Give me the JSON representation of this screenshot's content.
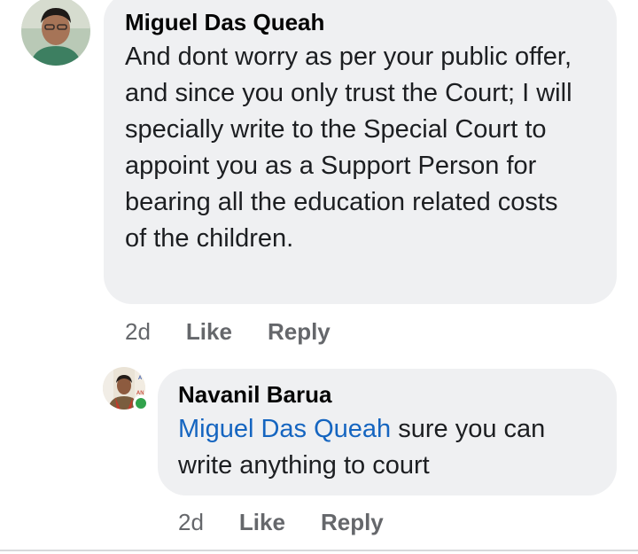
{
  "comments": [
    {
      "author": "Miguel Das Queah",
      "text": "And dont worry as per your public offer, and since you only trust the Court; I will specially write to the Special Court to appoint you as a Support Person for bearing all the education related costs of the children.",
      "time": "2d",
      "like_label": "Like",
      "reply_label": "Reply"
    }
  ],
  "replies": [
    {
      "author": "Navanil Barua",
      "mention": "Miguel Das Queah",
      "text": " sure you can write anything to court",
      "time": "2d",
      "like_label": "Like",
      "reply_label": "Reply",
      "online": true
    }
  ],
  "colors": {
    "bubble": "#eff0f2",
    "mention": "#1565c0",
    "meta": "#65676b",
    "online": "#31a24c"
  }
}
